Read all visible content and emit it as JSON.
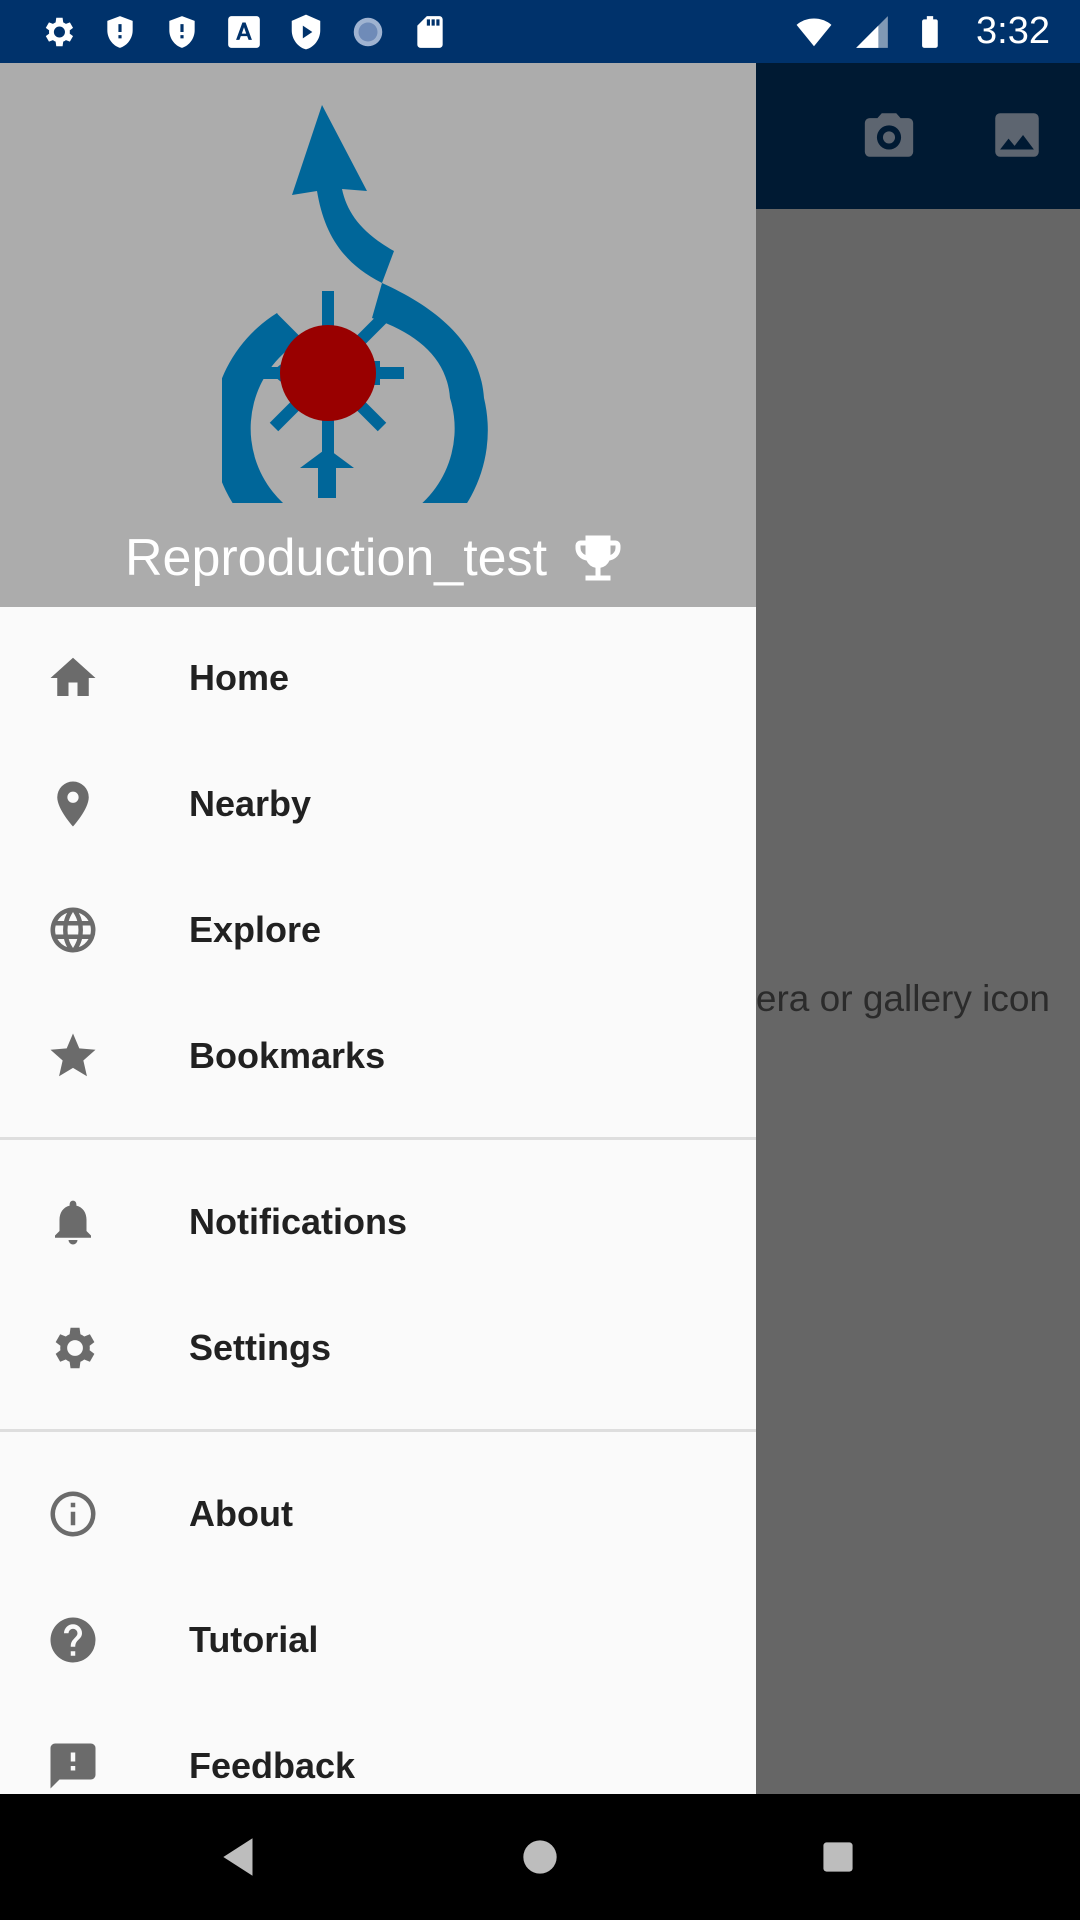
{
  "status_bar": {
    "time": "3:32",
    "left_icons": [
      "settings-icon",
      "shield-alert-icon",
      "shield-alert-icon",
      "font-download-icon",
      "play-shield-icon",
      "sync-circle-icon",
      "sd-card-icon"
    ],
    "right_icons": [
      "wifi-icon",
      "signal-icon",
      "battery-icon"
    ],
    "background": "#00326b"
  },
  "app": {
    "hint_text": "Tap the camera or gallery icon",
    "toolbar_actions": [
      "camera-icon",
      "gallery-icon"
    ]
  },
  "drawer": {
    "header_background": "#acacac",
    "username": "Reproduction_test",
    "username_icon": "trophy-icon",
    "groups": [
      [
        {
          "label": "Home",
          "icon": "home-icon"
        },
        {
          "label": "Nearby",
          "icon": "location-pin-icon"
        },
        {
          "label": "Explore",
          "icon": "globe-icon"
        },
        {
          "label": "Bookmarks",
          "icon": "star-icon"
        }
      ],
      [
        {
          "label": "Notifications",
          "icon": "bell-icon"
        },
        {
          "label": "Settings",
          "icon": "gear-icon"
        }
      ],
      [
        {
          "label": "About",
          "icon": "info-icon"
        },
        {
          "label": "Tutorial",
          "icon": "help-icon"
        },
        {
          "label": "Feedback",
          "icon": "feedback-icon"
        }
      ]
    ]
  },
  "nav_bar": {
    "buttons": [
      "back-icon",
      "home-circle-icon",
      "recents-icon"
    ]
  }
}
